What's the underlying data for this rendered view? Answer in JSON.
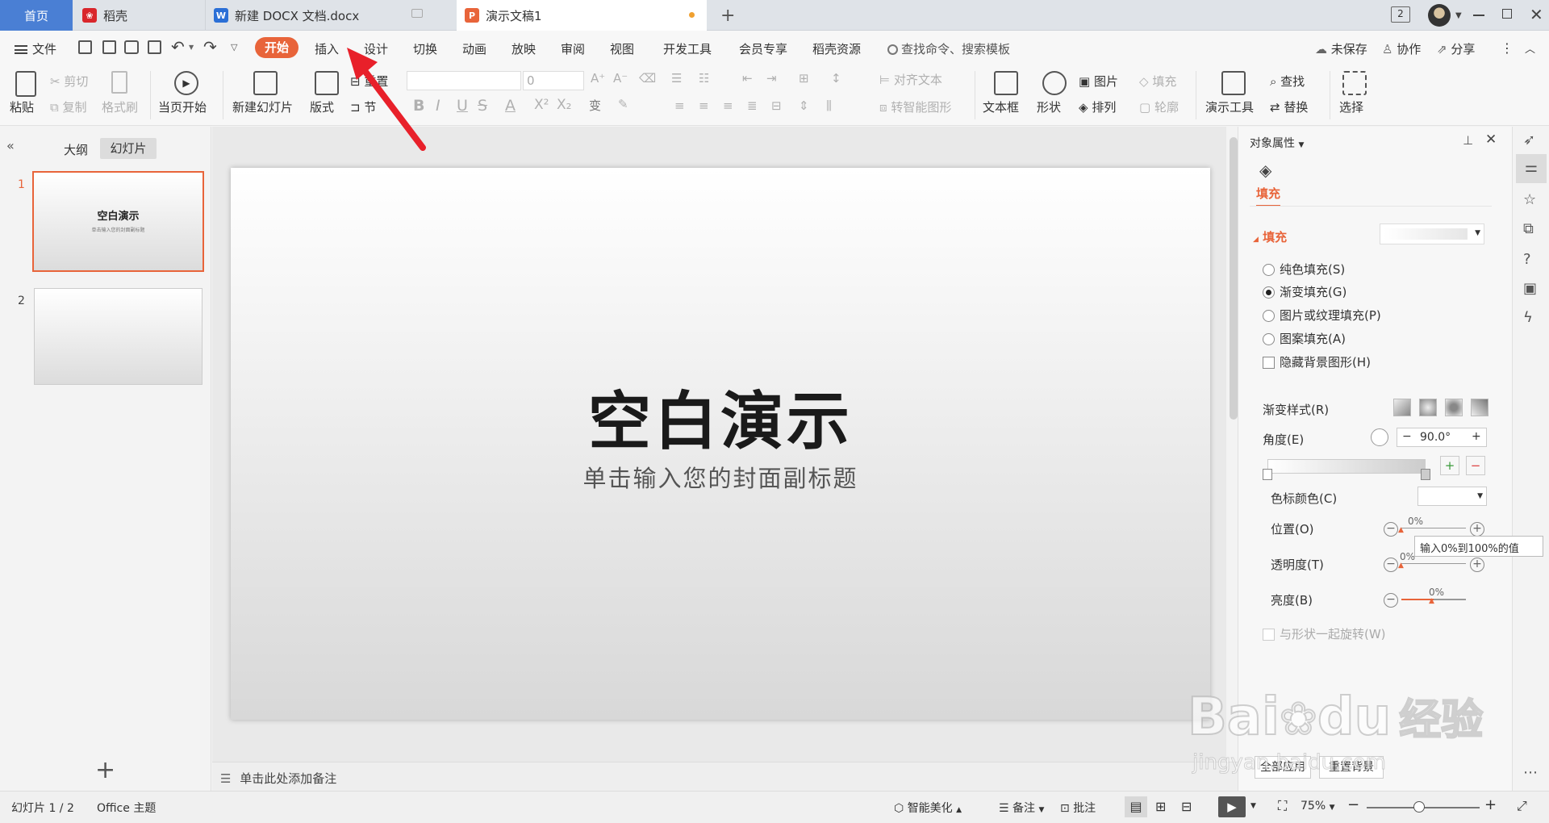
{
  "tabs": [
    {
      "label": "首页",
      "icon": "home-icon"
    },
    {
      "label": "稻壳",
      "icon": "docer-icon"
    },
    {
      "label": "新建 DOCX 文档.docx",
      "icon": "word-icon"
    },
    {
      "label": "演示文稿1",
      "icon": "ppt-icon"
    }
  ],
  "tab_new": "+",
  "window_badge": "2",
  "menu": {
    "file": "文件",
    "tabs": [
      "开始",
      "插入",
      "设计",
      "切换",
      "动画",
      "放映",
      "审阅",
      "视图",
      "开发工具",
      "会员专享",
      "稻壳资源"
    ],
    "search_placeholder": "查找命令、搜索模板",
    "unsaved": "未保存",
    "collab": "协作",
    "share": "分享"
  },
  "ribbon": {
    "paste": "粘贴",
    "cut": "剪切",
    "copy": "复制",
    "format_painter": "格式刷",
    "from_current": "当页开始",
    "new_slide": "新建幻灯片",
    "layout": "版式",
    "reset": "重置",
    "section": "节",
    "font_size": "0",
    "bold": "B",
    "italic": "I",
    "underline": "U",
    "strike": "S",
    "font_color": "A",
    "align_text": "对齐文本",
    "smart_shape": "转智能图形",
    "textbox": "文本框",
    "shape": "形状",
    "picture": "图片",
    "arrange": "排列",
    "fill": "填充",
    "outline": "轮廓",
    "present_tools": "演示工具",
    "find": "查找",
    "replace": "替换",
    "select": "选择"
  },
  "left_panel": {
    "outline_tab": "大纲",
    "slides_tab": "幻灯片",
    "slides": [
      {
        "num": "1",
        "title": "空白演示",
        "subtitle": "单击输入您的封面副标题"
      },
      {
        "num": "2",
        "title": "",
        "subtitle": ""
      }
    ],
    "add": "+"
  },
  "slide": {
    "title": "空白演示",
    "subtitle": "单击输入您的封面副标题"
  },
  "notes_placeholder": "单击此处添加备注",
  "right_panel": {
    "header": "对象属性",
    "fill_tab": "填充",
    "fill_section": "填充",
    "options": [
      {
        "label": "纯色填充(S)",
        "checked": false
      },
      {
        "label": "渐变填充(G)",
        "checked": true
      },
      {
        "label": "图片或纹理填充(P)",
        "checked": false
      },
      {
        "label": "图案填充(A)",
        "checked": false
      }
    ],
    "hide_bg": "隐藏背景图形(H)",
    "gradient_style": "渐变样式(R)",
    "angle_label": "角度(E)",
    "angle_value": "90.0°",
    "color_stop": "色标颜色(C)",
    "position": "位置(O)",
    "position_value": "0%",
    "transparency": "透明度(T)",
    "transparency_value": "0%",
    "brightness": "亮度(B)",
    "brightness_value": "0%",
    "tooltip": "输入0%到100%的值",
    "rotate_with_shape": "与形状一起旋转(W)",
    "apply_all": "全部应用",
    "reset_bg": "重置背景"
  },
  "status": {
    "slide_count": "幻灯片 1 / 2",
    "theme": "Office 主题",
    "beautify": "智能美化",
    "notes": "备注",
    "comments": "批注",
    "zoom": "75%"
  },
  "watermark": {
    "brand": "Bai",
    "brand2": "du",
    "cn": "经验",
    "url": "jingyan.baidu.com"
  },
  "colors": {
    "accent": "#e8643a",
    "active_tab_bg": "#ffffff",
    "arrow": "#e8202a"
  }
}
